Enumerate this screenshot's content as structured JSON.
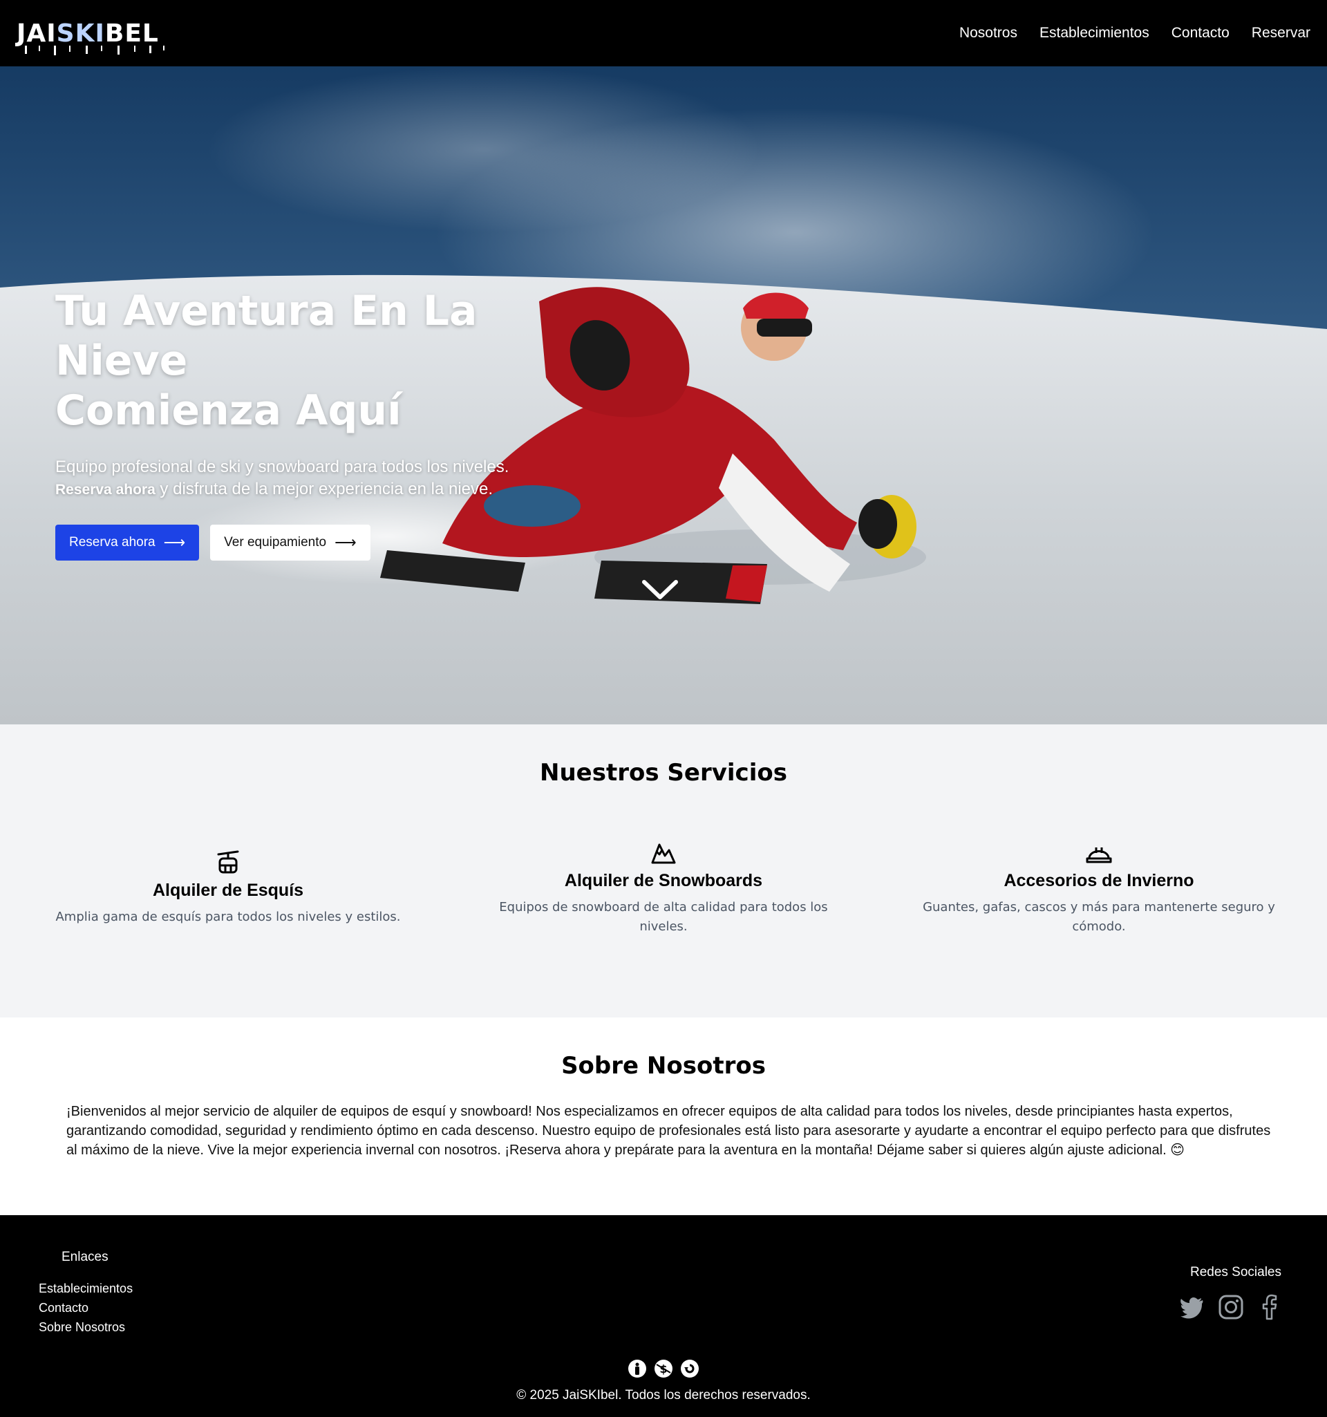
{
  "brand": {
    "logo_prefix": "JAI",
    "logo_highlight": "SKI",
    "logo_suffix": "BEL"
  },
  "nav": {
    "items": [
      {
        "label": "Nosotros"
      },
      {
        "label": "Establecimientos"
      },
      {
        "label": "Contacto"
      },
      {
        "label": "Reservar"
      }
    ]
  },
  "hero": {
    "title_line1": "Tu Aventura En La Nieve",
    "title_line2": "Comienza Aquí",
    "subtitle_line1": "Equipo profesional de ski y snowboard para todos los niveles.",
    "subtitle_bold": "Reserva ahora",
    "subtitle_rest": " y disfruta de la mejor experiencia en la nieve.",
    "primary_button": "Reserva ahora",
    "secondary_button": "Ver equipamiento",
    "button_arrow": "⟶",
    "colors": {
      "primary": "#1d43e6",
      "sky": "#1f4670",
      "snow": "#d8dde2",
      "suit": "#b3161f"
    }
  },
  "services": {
    "title": "Nuestros Servicios",
    "items": [
      {
        "icon": "cable-car-icon",
        "title": "Alquiler de Esquís",
        "description": "Amplia gama de esquís para todos los niveles y estilos."
      },
      {
        "icon": "mountain-icon",
        "title": "Alquiler de Snowboards",
        "description": "Equipos de snowboard de alta calidad para todos los niveles."
      },
      {
        "icon": "helmet-icon",
        "title": "Accesorios de Invierno",
        "description": "Guantes, gafas, cascos y más para mantenerte seguro y cómodo."
      }
    ]
  },
  "about": {
    "title": "Sobre Nosotros",
    "text": "¡Bienvenidos al mejor servicio de alquiler de equipos de esquí y snowboard! Nos especializamos en ofrecer equipos de alta calidad para todos los niveles, desde principiantes hasta expertos, garantizando comodidad, seguridad y rendimiento óptimo en cada descenso. Nuestro equipo de profesionales está listo para asesorarte y ayudarte a encontrar el equipo perfecto para que disfrutes al máximo de la nieve. Vive la mejor experiencia invernal con nosotros. ¡Reserva ahora y prepárate para la aventura en la montaña! Déjame saber si quieres algún ajuste adicional. 😊"
  },
  "footer": {
    "links_heading": "Enlaces",
    "links": [
      {
        "label": "Establecimientos"
      },
      {
        "label": "Contacto"
      },
      {
        "label": "Sobre Nosotros"
      }
    ],
    "social_heading": "Redes Sociales",
    "social": [
      "twitter-icon",
      "instagram-icon",
      "facebook-icon"
    ],
    "credit_icons": [
      "creative-commons-by-icon",
      "creative-commons-nc-icon",
      "creative-commons-sa-icon"
    ],
    "copyright": "© 2025 JaiSKIbel. Todos los derechos reservados."
  }
}
